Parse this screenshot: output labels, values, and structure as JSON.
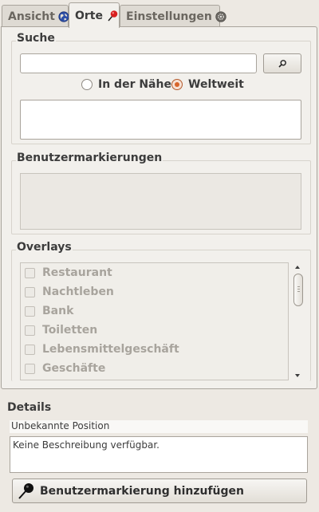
{
  "tabs": [
    {
      "label": "Ansicht",
      "icon": "globe-icon",
      "active": false
    },
    {
      "label": "Orte",
      "icon": "pushpin-icon",
      "active": true
    },
    {
      "label": "Einstellungen",
      "icon": "gear-icon",
      "active": false
    }
  ],
  "search": {
    "title": "Suche",
    "query": "",
    "button_icon": "search-icon",
    "scope_options": [
      "In der Nähe",
      "Weltweit"
    ],
    "selected_scope": "Weltweit"
  },
  "user_markers": {
    "title": "Benutzermarkierungen"
  },
  "overlays": {
    "title": "Overlays",
    "items": [
      "Restaurant",
      "Nachtleben",
      "Bank",
      "Toiletten",
      "Lebensmittelgeschäft",
      "Geschäfte"
    ]
  },
  "details": {
    "title": "Details",
    "position": "Unbekannte Position",
    "description": "Keine Beschreibung verfügbar.",
    "add_button": "Benutzermarkierung hinzufügen",
    "add_button_icon": "pushpin-icon"
  },
  "colors": {
    "accent": "#d8642a",
    "pin": "#d81f1f"
  }
}
